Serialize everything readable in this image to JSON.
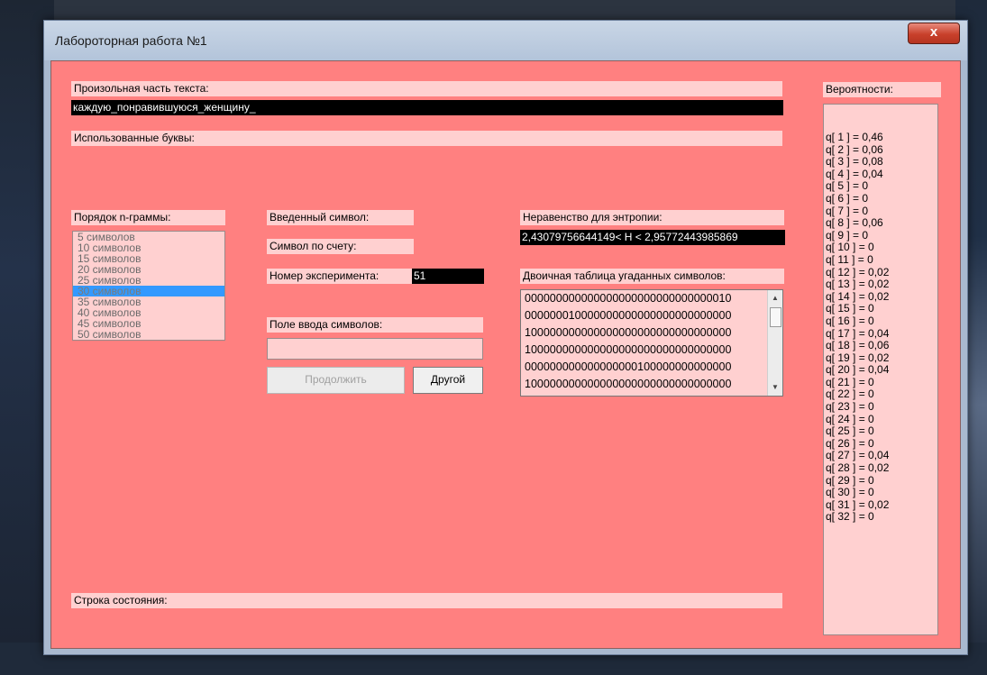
{
  "window": {
    "title": "Лабороторная работа №1",
    "close_label": "x"
  },
  "text_part": {
    "label": "Произольная часть текста:",
    "value": "каждую_понравившуюся_женщину_"
  },
  "used_letters": {
    "label": "Использованные буквы:",
    "value": ""
  },
  "ngram": {
    "label": "Порядок n-граммы:",
    "options": [
      "5 символов",
      "10 символов",
      "15 символов",
      "20 символов",
      "25 символов",
      "30 символов",
      "35 символов",
      "40 символов",
      "45 символов",
      "50 символов"
    ],
    "selected": "30 символов"
  },
  "entered_symbol": {
    "label": "Введенный символ:",
    "value": ""
  },
  "symbol_count": {
    "label": "Символ по счету:",
    "value": ""
  },
  "experiment_number": {
    "label": "Номер эксперимента:",
    "value": "51"
  },
  "input_field": {
    "label": "Поле ввода символов:",
    "value": ""
  },
  "buttons": {
    "continue": "Продолжить",
    "other": "Другой"
  },
  "entropy": {
    "label": "Неравенство для энтропии:",
    "value": "2,43079756644149< H < 2,95772443985869"
  },
  "binary_table": {
    "label": "Двоичная таблица угаданных символов:",
    "rows": [
      "000000000000000000000000000000010",
      "000000010000000000000000000000000",
      "100000000000000000000000000000000",
      "100000000000000000000000000000000",
      "000000000000000000100000000000000",
      "100000000000000000000000000000000"
    ]
  },
  "probabilities": {
    "label": "Вероятности:",
    "items": [
      "q[ 1 ] = 0,46",
      "q[ 2 ] = 0,06",
      "q[ 3 ] = 0,08",
      "q[ 4 ] = 0,04",
      "q[ 5 ] = 0",
      "q[ 6 ] = 0",
      "q[ 7 ] = 0",
      "q[ 8 ] = 0,06",
      "q[ 9 ] = 0",
      "q[ 10 ] = 0",
      "q[ 11 ] = 0",
      "q[ 12 ] = 0,02",
      "q[ 13 ] = 0,02",
      "q[ 14 ] = 0,02",
      "q[ 15 ] = 0",
      "q[ 16 ] = 0",
      "q[ 17 ] = 0,04",
      "q[ 18 ] = 0,06",
      "q[ 19 ] = 0,02",
      "q[ 20 ] = 0,04",
      "q[ 21 ] = 0",
      "q[ 22 ] = 0",
      "q[ 23 ] = 0",
      "q[ 24 ] = 0",
      "q[ 25 ] = 0",
      "q[ 26 ] = 0",
      "q[ 27 ] = 0,04",
      "q[ 28 ] = 0,02",
      "q[ 29 ] = 0",
      "q[ 30 ] = 0",
      "q[ 31 ] = 0,02",
      "q[ 32 ] = 0"
    ]
  },
  "status": {
    "label": "Строка состояния:",
    "value": ""
  },
  "colors": {
    "client_bg": "#ff8080",
    "label_bg": "#ffd0d0",
    "field_bg": "#000000",
    "selection": "#3399ff"
  }
}
